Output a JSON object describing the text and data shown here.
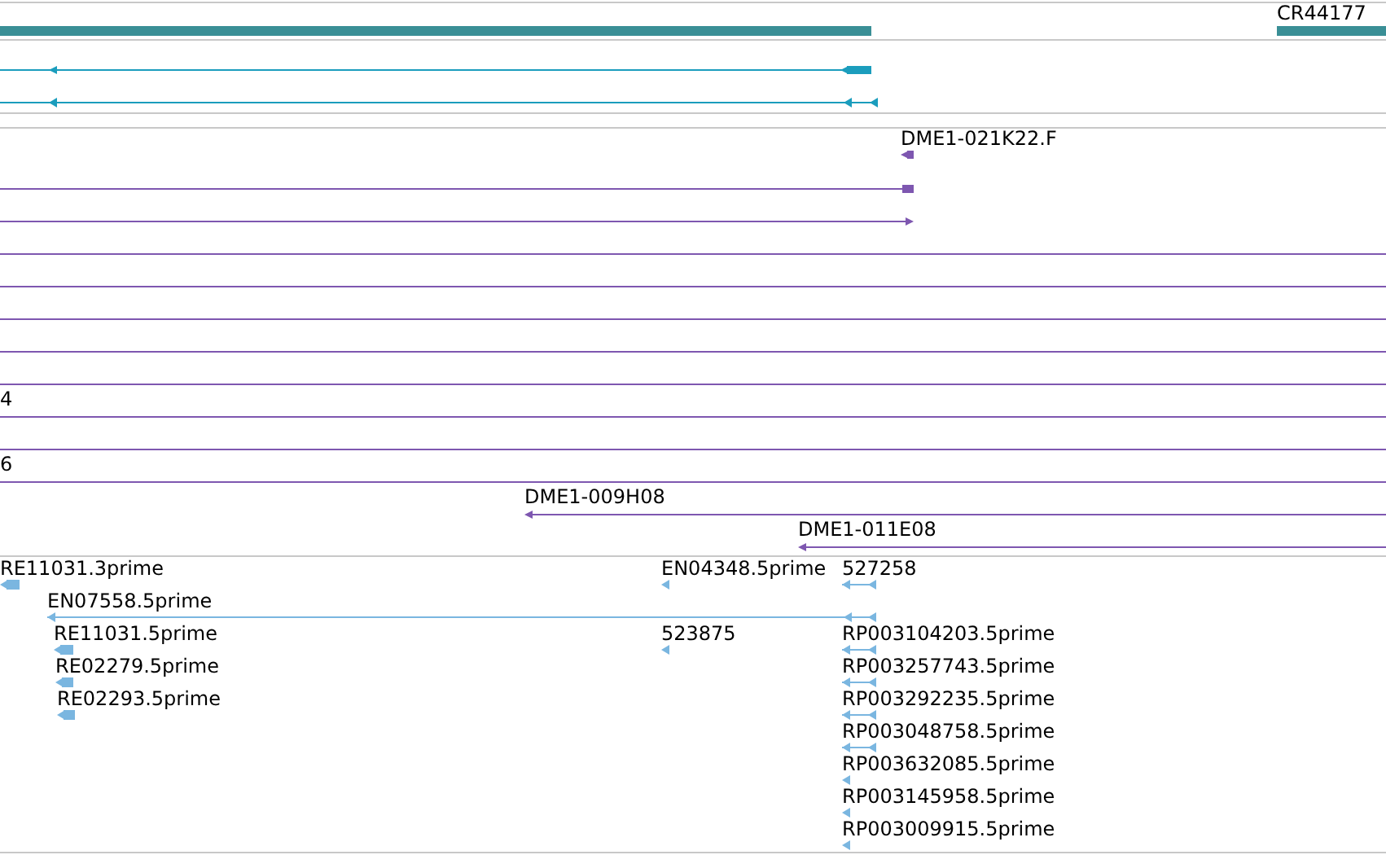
{
  "tracks": [
    {
      "kind": "gene",
      "features": [
        {
          "kind": "bar"
        },
        {
          "kind": "bar",
          "label": "CR44177"
        }
      ]
    },
    {
      "kind": "transcript",
      "features": [
        {
          "kind": "arrow",
          "reverse": true
        },
        {
          "kind": "arrow",
          "reverse": true
        }
      ]
    },
    {
      "kind": "clone",
      "features": [
        {
          "kind": "arrow",
          "label": "DME1-021K22.F",
          "reverse": true
        },
        {
          "kind": "line"
        },
        {
          "kind": "arrow",
          "reverse": false
        },
        {
          "kind": "line"
        },
        {
          "kind": "line"
        },
        {
          "kind": "line"
        },
        {
          "kind": "line"
        },
        {
          "kind": "line"
        },
        {
          "kind": "line",
          "label": "4"
        },
        {
          "kind": "line"
        },
        {
          "kind": "line",
          "label": "6"
        },
        {
          "kind": "arrow",
          "label": "DME1-009H08",
          "reverse": true
        },
        {
          "kind": "arrow",
          "label": "DME1-011E08",
          "reverse": true
        }
      ]
    },
    {
      "kind": "est",
      "features": [
        {
          "kind": "arrow",
          "label": "RE11031.3prime",
          "reverse": true
        },
        {
          "kind": "arrow",
          "label": "EN04348.5prime",
          "reverse": true
        },
        {
          "kind": "arrow",
          "label": "527258",
          "reverse": true
        },
        {
          "kind": "arrow",
          "label": "EN07558.5prime",
          "reverse": true
        },
        {
          "kind": "arrow",
          "label": "RE11031.5prime",
          "reverse": true
        },
        {
          "kind": "arrow",
          "label": "523875",
          "reverse": true
        },
        {
          "kind": "arrow",
          "label": "RP003104203.5prime",
          "reverse": true
        },
        {
          "kind": "arrow",
          "label": "RE02279.5prime",
          "reverse": true
        },
        {
          "kind": "arrow",
          "label": "RP003257743.5prime",
          "reverse": true
        },
        {
          "kind": "arrow",
          "label": "RE02293.5prime",
          "reverse": true
        },
        {
          "kind": "arrow",
          "label": "RP003292235.5prime",
          "reverse": true
        },
        {
          "kind": "arrow",
          "label": "RP003048758.5prime",
          "reverse": true
        },
        {
          "kind": "arrow",
          "label": "RP003632085.5prime",
          "reverse": true
        },
        {
          "kind": "arrow",
          "label": "RP003145958.5prime",
          "reverse": true
        },
        {
          "kind": "arrow",
          "label": "RP003009915.5prime",
          "reverse": true
        }
      ]
    }
  ]
}
